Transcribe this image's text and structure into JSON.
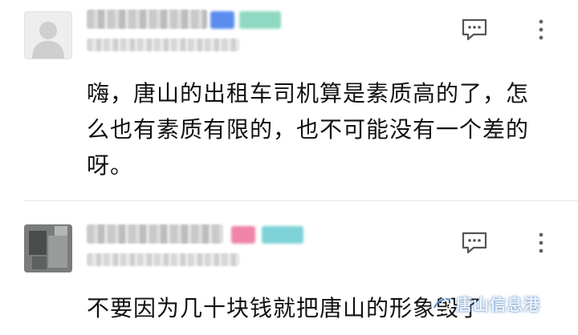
{
  "comments": [
    {
      "username": "",
      "meta": "",
      "badge_colors": [
        "#5b8def",
        "#8fd9c3"
      ],
      "text": "嗨，唐山的出租车司机算是素质高的了，怎么也有素质有限的，也不可能没有一个差的呀。"
    },
    {
      "username": "",
      "meta": "",
      "badge_colors": [
        "#ef86a8",
        "#7ed3d8"
      ],
      "text": "不要因为几十块钱就把唐山的形象毁了"
    }
  ],
  "icons": {
    "comment": "comment-icon",
    "more": "more-vertical-icon",
    "avatar_placeholder": "default-avatar-icon"
  },
  "watermark": {
    "text": "唐山信息港"
  }
}
